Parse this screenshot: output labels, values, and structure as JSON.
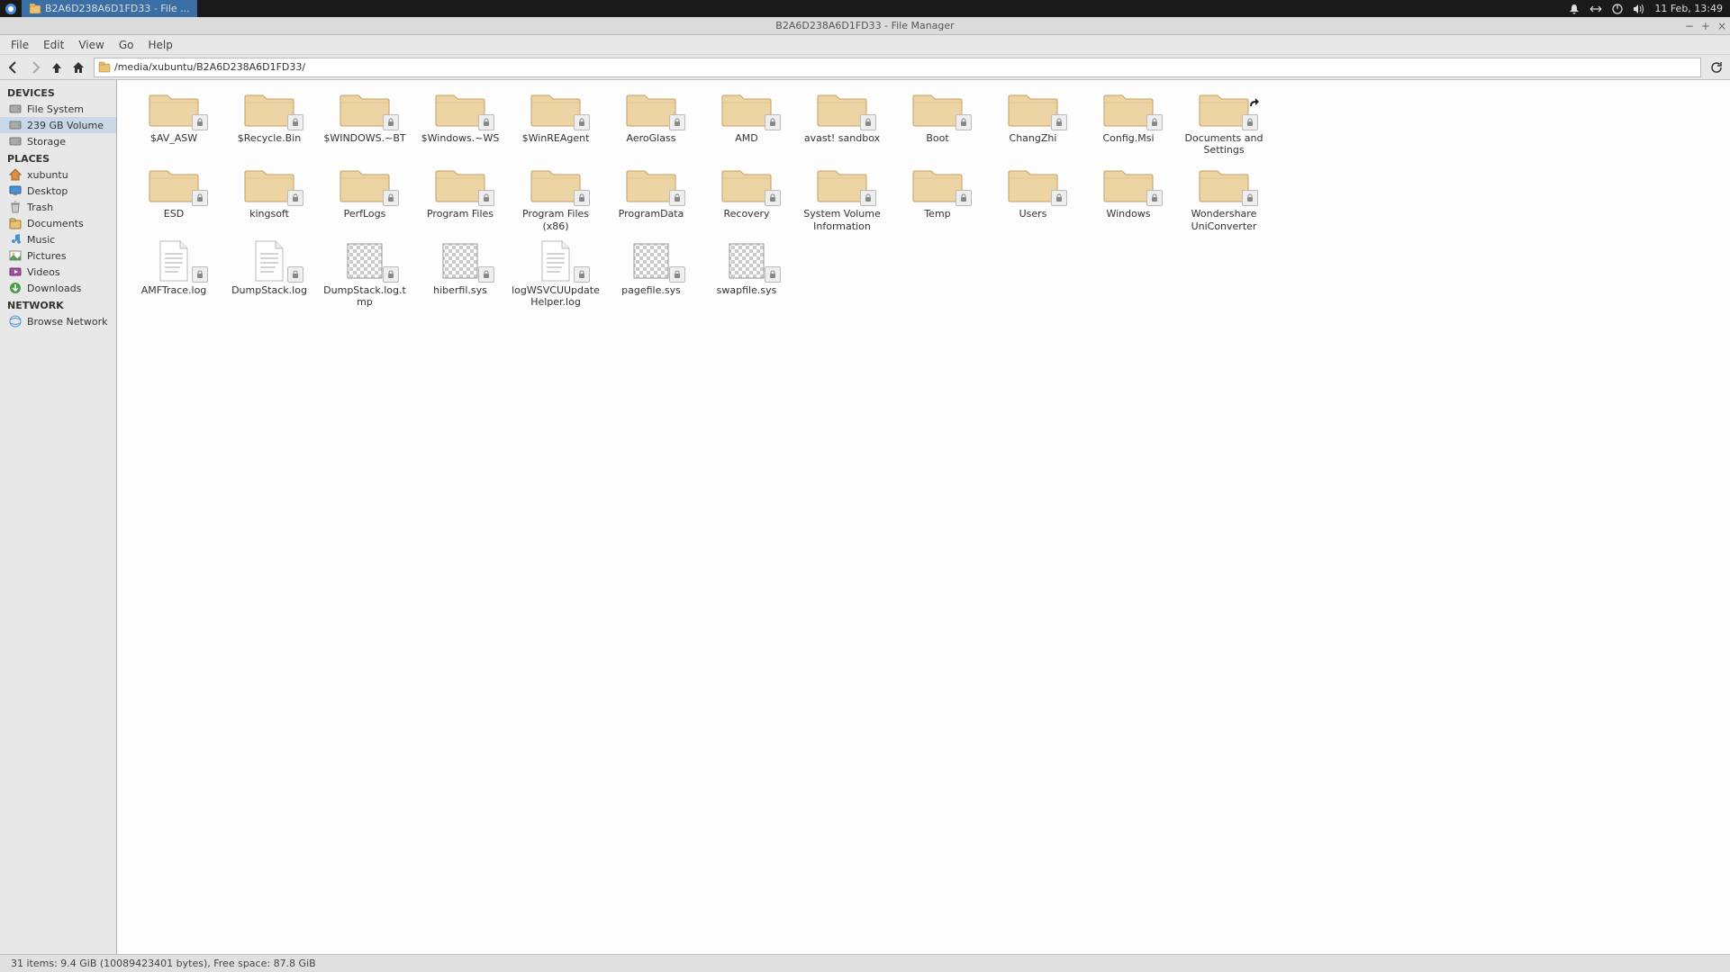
{
  "taskbar": {
    "active_app": "B2A6D238A6D1FD33 - File ...",
    "clock": "11 Feb, 13:49"
  },
  "window": {
    "title": "B2A6D238A6D1FD33 - File Manager"
  },
  "menubar": [
    "File",
    "Edit",
    "View",
    "Go",
    "Help"
  ],
  "pathbar": {
    "path": "/media/xubuntu/B2A6D238A6D1FD33/"
  },
  "sidebar": {
    "groups": [
      {
        "header": "DEVICES",
        "items": [
          {
            "label": "File System",
            "icon": "disk"
          },
          {
            "label": "239 GB Volume",
            "icon": "disk",
            "selected": true
          },
          {
            "label": "Storage",
            "icon": "disk"
          }
        ]
      },
      {
        "header": "PLACES",
        "items": [
          {
            "label": "xubuntu",
            "icon": "home"
          },
          {
            "label": "Desktop",
            "icon": "desktop"
          },
          {
            "label": "Trash",
            "icon": "trash"
          },
          {
            "label": "Documents",
            "icon": "folder"
          },
          {
            "label": "Music",
            "icon": "music"
          },
          {
            "label": "Pictures",
            "icon": "pictures"
          },
          {
            "label": "Videos",
            "icon": "video"
          },
          {
            "label": "Downloads",
            "icon": "download"
          }
        ]
      },
      {
        "header": "NETWORK",
        "items": [
          {
            "label": "Browse Network",
            "icon": "network"
          }
        ]
      }
    ]
  },
  "files": [
    {
      "name": "$AV_ASW",
      "type": "folder",
      "locked": true
    },
    {
      "name": "$Recycle.Bin",
      "type": "folder",
      "locked": true
    },
    {
      "name": "$WINDOWS.~BT",
      "type": "folder",
      "locked": true
    },
    {
      "name": "$Windows.~WS",
      "type": "folder",
      "locked": true
    },
    {
      "name": "$WinREAgent",
      "type": "folder",
      "locked": true
    },
    {
      "name": "AeroGlass",
      "type": "folder",
      "locked": true
    },
    {
      "name": "AMD",
      "type": "folder",
      "locked": true
    },
    {
      "name": "avast! sandbox",
      "type": "folder",
      "locked": true
    },
    {
      "name": "Boot",
      "type": "folder",
      "locked": true
    },
    {
      "name": "ChangZhi",
      "type": "folder",
      "locked": true
    },
    {
      "name": "Config.Msi",
      "type": "folder",
      "locked": true
    },
    {
      "name": "Documents and Settings",
      "type": "folder",
      "locked": true,
      "link": true
    },
    {
      "name": "ESD",
      "type": "folder",
      "locked": true
    },
    {
      "name": "kingsoft",
      "type": "folder",
      "locked": true
    },
    {
      "name": "PerfLogs",
      "type": "folder",
      "locked": true
    },
    {
      "name": "Program Files",
      "type": "folder",
      "locked": true
    },
    {
      "name": "Program Files (x86)",
      "type": "folder",
      "locked": true
    },
    {
      "name": "ProgramData",
      "type": "folder",
      "locked": true
    },
    {
      "name": "Recovery",
      "type": "folder",
      "locked": true
    },
    {
      "name": "System Volume Information",
      "type": "folder",
      "locked": true
    },
    {
      "name": "Temp",
      "type": "folder",
      "locked": true
    },
    {
      "name": "Users",
      "type": "folder",
      "locked": true
    },
    {
      "name": "Windows",
      "type": "folder",
      "locked": true
    },
    {
      "name": "Wondershare UniConverter",
      "type": "folder",
      "locked": true
    },
    {
      "name": "AMFTrace.log",
      "type": "text",
      "locked": true
    },
    {
      "name": "DumpStack.log",
      "type": "text",
      "locked": true
    },
    {
      "name": "DumpStack.log.tmp",
      "type": "image",
      "locked": true
    },
    {
      "name": "hiberfil.sys",
      "type": "image",
      "locked": true
    },
    {
      "name": "logWSVCUUpdateHelper.log",
      "type": "text",
      "locked": true
    },
    {
      "name": "pagefile.sys",
      "type": "image",
      "locked": true
    },
    {
      "name": "swapfile.sys",
      "type": "image",
      "locked": true
    }
  ],
  "statusbar": {
    "text": "31 items: 9.4 GiB (10089423401 bytes), Free space: 87.8 GiB"
  }
}
